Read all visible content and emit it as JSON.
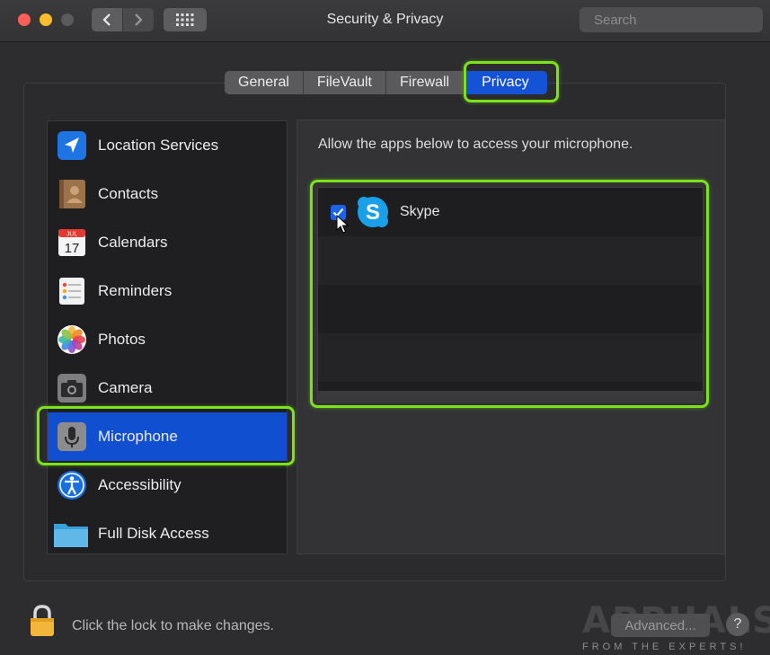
{
  "window": {
    "title": "Security & Privacy",
    "search_placeholder": "Search"
  },
  "tabs": [
    {
      "label": "General",
      "active": false
    },
    {
      "label": "FileVault",
      "active": false
    },
    {
      "label": "Firewall",
      "active": false
    },
    {
      "label": "Privacy",
      "active": true
    }
  ],
  "sidebar": {
    "items": [
      {
        "label": "Location Services",
        "icon": "location-arrow-icon"
      },
      {
        "label": "Contacts",
        "icon": "contacts-book-icon"
      },
      {
        "label": "Calendars",
        "icon": "calendar-icon",
        "icon_month": "JUL",
        "icon_day": "17"
      },
      {
        "label": "Reminders",
        "icon": "reminders-list-icon"
      },
      {
        "label": "Photos",
        "icon": "photos-flower-icon"
      },
      {
        "label": "Camera",
        "icon": "camera-icon"
      },
      {
        "label": "Microphone",
        "icon": "microphone-icon",
        "selected": true
      },
      {
        "label": "Accessibility",
        "icon": "accessibility-icon"
      },
      {
        "label": "Full Disk Access",
        "icon": "folder-icon"
      }
    ]
  },
  "pane": {
    "description": "Allow the apps below to access your microphone.",
    "apps": [
      {
        "name": "Skype",
        "checked": true,
        "icon": "skype-icon"
      }
    ]
  },
  "footer": {
    "lock_text": "Click the lock to make changes.",
    "advanced_label": "Advanced...",
    "help_label": "?"
  },
  "watermark": {
    "main": "APPUALS",
    "sub": "FROM THE EXPERTS!"
  },
  "colors": {
    "accent": "#1452d6",
    "highlight": "#7be31a",
    "selected": "#0f4fd0"
  }
}
